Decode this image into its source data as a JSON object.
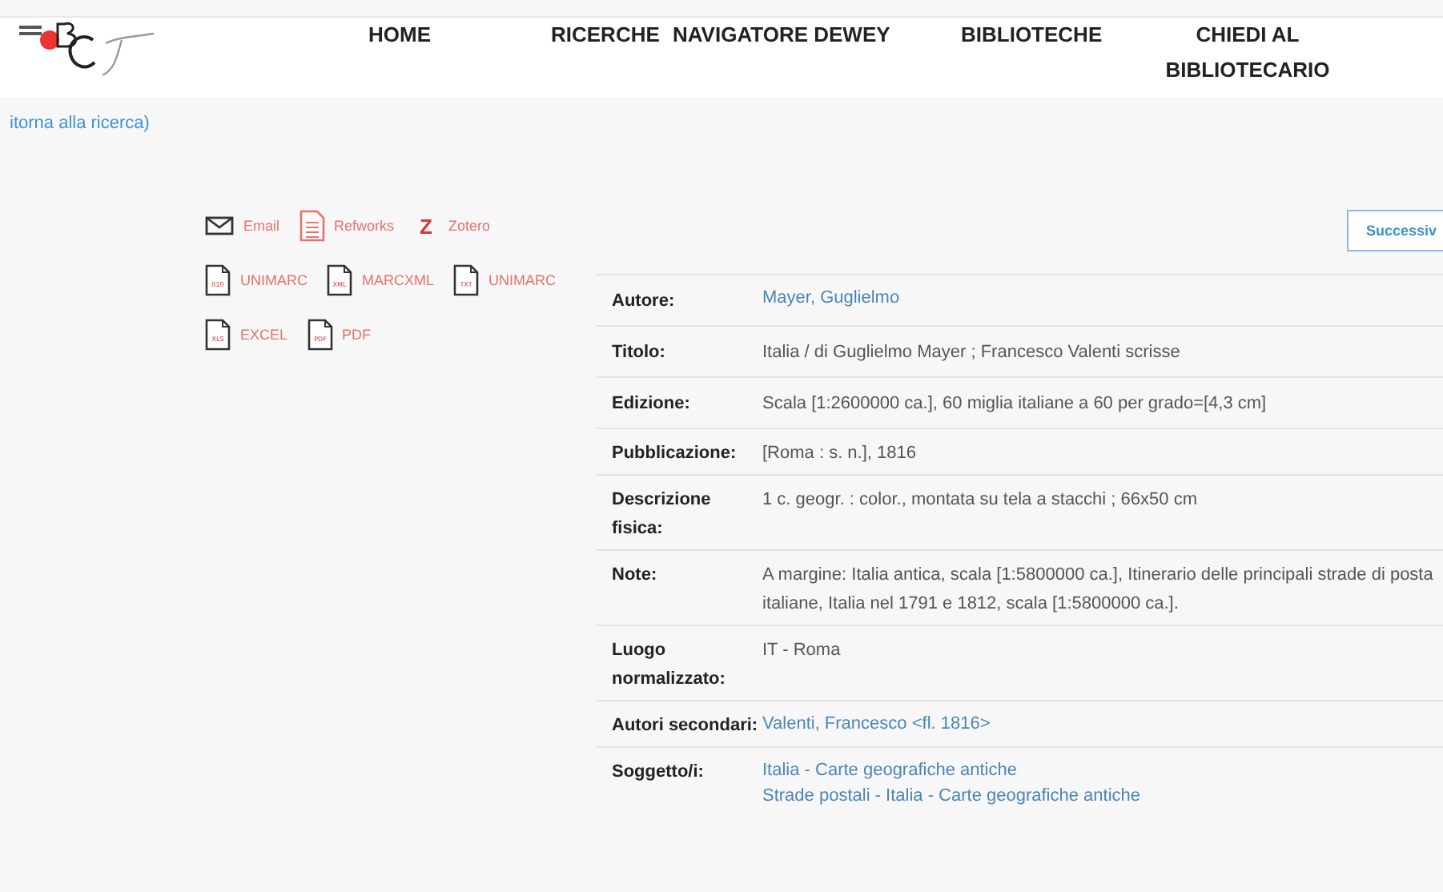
{
  "nav": [
    {
      "label": "HOME"
    },
    {
      "label": "RICERCHE"
    },
    {
      "label": "NAVIGATORE DEWEY"
    },
    {
      "label": "BIBLIOTECHE"
    },
    {
      "label": "CHIEDI AL BIBLIOTECARIO"
    }
  ],
  "back_link": "itorna alla ricerca)",
  "exports": [
    [
      {
        "kind": "email",
        "label": "Email"
      },
      {
        "kind": "refworks",
        "label": "Refworks"
      },
      {
        "kind": "zotero",
        "glyph": "Z",
        "label": "Zotero"
      }
    ],
    [
      {
        "kind": "file",
        "tag": "010",
        "label": "UNIMARC"
      },
      {
        "kind": "file",
        "tag": "XML",
        "label": "MARCXML"
      },
      {
        "kind": "file",
        "tag": "TXT",
        "label": "UNIMARC"
      }
    ],
    [
      {
        "kind": "file",
        "tag": "XLS",
        "label": "EXCEL"
      },
      {
        "kind": "file",
        "tag": "PDF",
        "label": "PDF"
      }
    ]
  ],
  "next_button": "Successiv",
  "record": [
    {
      "label": "Autore:",
      "kind": "link",
      "values": [
        "Mayer, Guglielmo"
      ]
    },
    {
      "label": "Titolo:",
      "kind": "text",
      "values": [
        "Italia / di Guglielmo Mayer ; Francesco Valenti scrisse"
      ]
    },
    {
      "label": "Edizione:",
      "kind": "text",
      "values": [
        "Scala [1:2600000 ca.], 60 miglia italiane a 60 per grado=[4,3 cm]"
      ]
    },
    {
      "label": "Pubblicazione:",
      "kind": "text",
      "values": [
        "[Roma : s. n.], 1816"
      ]
    },
    {
      "label": "Descrizione fisica:",
      "kind": "text",
      "values": [
        "1 c. geogr. : color., montata su tela a stacchi ; 66x50 cm"
      ]
    },
    {
      "label": "Note:",
      "kind": "text",
      "values": [
        "A margine: Italia antica, scala [1:5800000 ca.], Itinerario delle principali strade di posta italiane, Italia nel 1791 e 1812, scala [1:5800000 ca.]."
      ]
    },
    {
      "label": "Luogo normalizzato:",
      "kind": "text",
      "values": [
        "IT - Roma"
      ]
    },
    {
      "label": "Autori secondari:",
      "kind": "link",
      "values": [
        "Valenti, Francesco <fl. 1816>"
      ]
    },
    {
      "label": "Soggetto/i:",
      "kind": "link",
      "values": [
        "Italia - Carte geografiche antiche",
        "Strade postali - Italia - Carte geografiche antiche"
      ]
    }
  ]
}
